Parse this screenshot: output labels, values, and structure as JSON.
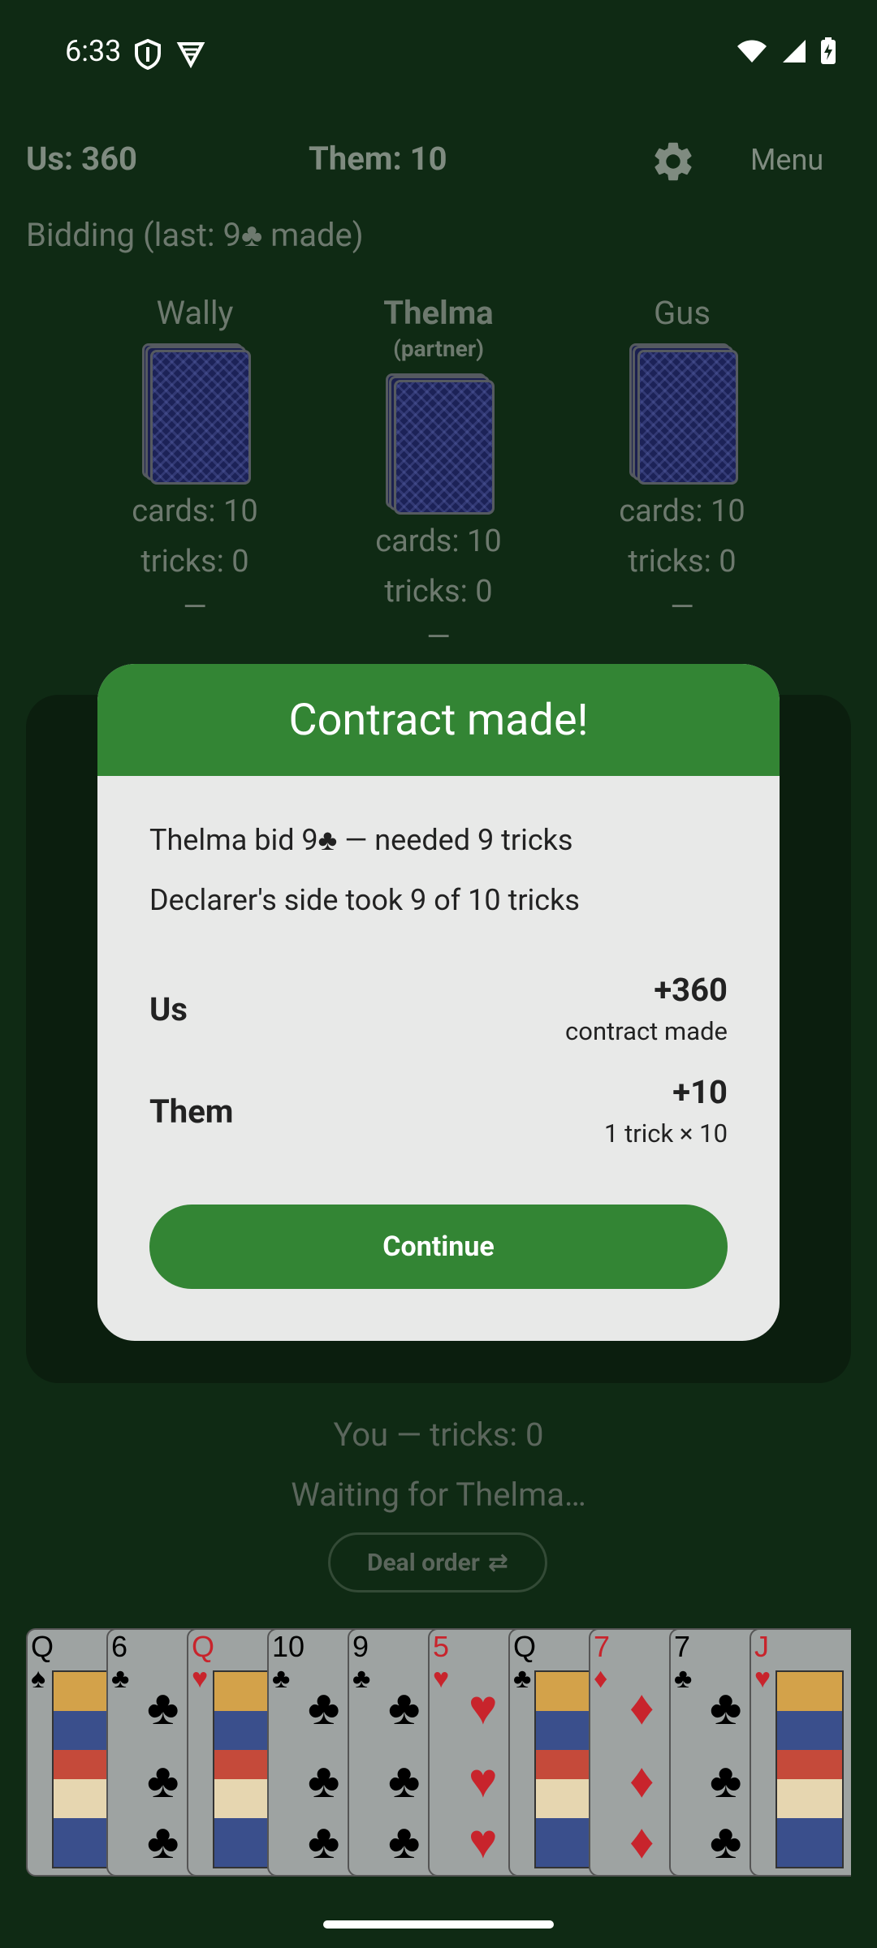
{
  "status_bar": {
    "time": "6:33",
    "left_icons": [
      "shield-icon",
      "vpn-icon"
    ],
    "right_icons": [
      "wifi-icon",
      "signal-icon",
      "battery-charging-icon"
    ]
  },
  "header": {
    "us_score": "Us: 360",
    "them_score": "Them: 10",
    "menu_label": "Menu"
  },
  "bidding_status": "Bidding  (last: 9♣ made)",
  "players": [
    {
      "name": "Wally",
      "partner_label": "",
      "cards": "cards: 10",
      "tricks": "tricks: 0",
      "bid": "—"
    },
    {
      "name": "Thelma",
      "partner_label": "(partner)",
      "cards": "cards: 10",
      "tricks": "tricks: 0",
      "bid": "—"
    },
    {
      "name": "Gus",
      "partner_label": "",
      "cards": "cards: 10",
      "tricks": "tricks: 0",
      "bid": "—"
    }
  ],
  "you_tricks": "You — tricks: 0",
  "waiting_text": "Waiting for Thelma…",
  "deal_order_label": "Deal order",
  "deal_order_icon": "⇄",
  "hand": [
    {
      "rank": "Q",
      "suit": "♠",
      "color": "black"
    },
    {
      "rank": "6",
      "suit": "♣",
      "color": "black"
    },
    {
      "rank": "Q",
      "suit": "♥",
      "color": "red"
    },
    {
      "rank": "10",
      "suit": "♣",
      "color": "black"
    },
    {
      "rank": "9",
      "suit": "♣",
      "color": "black"
    },
    {
      "rank": "5",
      "suit": "♥",
      "color": "red"
    },
    {
      "rank": "Q",
      "suit": "♣",
      "color": "black"
    },
    {
      "rank": "7",
      "suit": "♦",
      "color": "red"
    },
    {
      "rank": "7",
      "suit": "♣",
      "color": "black"
    },
    {
      "rank": "J",
      "suit": "♥",
      "color": "red"
    }
  ],
  "dialog": {
    "title": "Contract made!",
    "bid_line": "Thelma bid 9♣ — needed 9 tricks",
    "took_line": "Declarer's side took 9 of 10 tricks",
    "us_label": "Us",
    "us_amount": "+360",
    "us_note": "contract made",
    "them_label": "Them",
    "them_amount": "+10",
    "them_note": "1 trick × 10",
    "continue_label": "Continue"
  },
  "colors": {
    "background": "#0f2a14",
    "accent_green": "#338534",
    "dialog_bg": "#e8e9e8"
  }
}
